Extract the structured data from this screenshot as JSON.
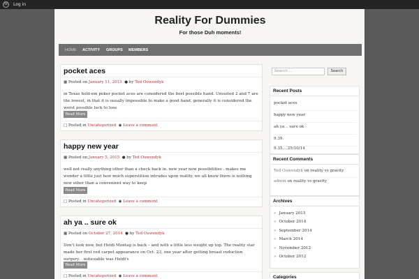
{
  "adminbar": {
    "wp_icon": "W",
    "login": "Log in"
  },
  "site": {
    "title": "Reality For Dummies",
    "description": "For those Duh moments!"
  },
  "nav": {
    "items": [
      "Home",
      "Activity",
      "Groups",
      "Members"
    ]
  },
  "posts": [
    {
      "title": "pocket aces",
      "posted_on": "Posted on",
      "date": "January 11, 2015",
      "by": "by",
      "author": "Ted Ouwendyk",
      "excerpt": "in Texas hold-em poker pocket aces are considered the best possible hand.  Unsuited 2 and 7 are the lowest, in that it is usually impossible to make a good hand. generally it is considered the worst possible luck to lose",
      "read_more": "Read More",
      "posted_in": "Posted in",
      "category": "Uncategorized",
      "comment": "Leave a comment"
    },
    {
      "title": "happy new year",
      "posted_on": "Posted on",
      "date": "January 5, 2015",
      "by": "by",
      "author": "Ted Ouwendyk",
      "excerpt": "well not really anything other than a check back in.  new year new possibilities . makes me wonder a little just how much superstition intrudes upon reality. we all know there is nothing new other than a convenient way to keep",
      "read_more": "Read More",
      "posted_in": "Posted in",
      "category": "Uncategorized",
      "comment": "Leave a comment"
    },
    {
      "title": "ah ya .. sure ok",
      "posted_on": "Posted on",
      "date": "October 27, 2014",
      "by": "by",
      "author": "Ted Ouwendyk",
      "excerpt": "Don't look now, but Heidi Montag is back – and with a little less weight up top. The reality star made her first red carpet appearance on Oct. 23, one year after getting breast reduction surgery. . noticeable was Heidi's",
      "read_more": "Read More",
      "posted_in": "Posted in",
      "category": "Uncategorized",
      "comment": "Leave a comment"
    }
  ],
  "search": {
    "placeholder": "Search ...",
    "button": "Search"
  },
  "recent_posts": {
    "title": "Recent Posts",
    "items": [
      "pocket aces",
      "happy new year",
      "ah ya .. sure ok",
      "9.39.",
      "9.35....25/10/14"
    ]
  },
  "recent_comments": {
    "title": "Recent Comments",
    "items": [
      {
        "author": "Ted Ouwendyk",
        "on": "on",
        "post": "reality vs gravity"
      },
      {
        "author": "admin",
        "on": "on",
        "post": "reality vs gravity"
      }
    ]
  },
  "archives": {
    "title": "Archives",
    "items": [
      "January 2015",
      "October 2014",
      "September 2014",
      "March 2014",
      "November 2012",
      "October 2012"
    ]
  },
  "categories": {
    "title": "Categories"
  },
  "colors": {
    "link": "#b92d2d",
    "background": "#5a5a5a",
    "nav": "#6f6f6f",
    "button": "#8b8b8b"
  },
  "icons": {
    "date": "calendar-icon",
    "author": "user-icon",
    "folder": "folder-icon",
    "comment": "comment-icon"
  }
}
